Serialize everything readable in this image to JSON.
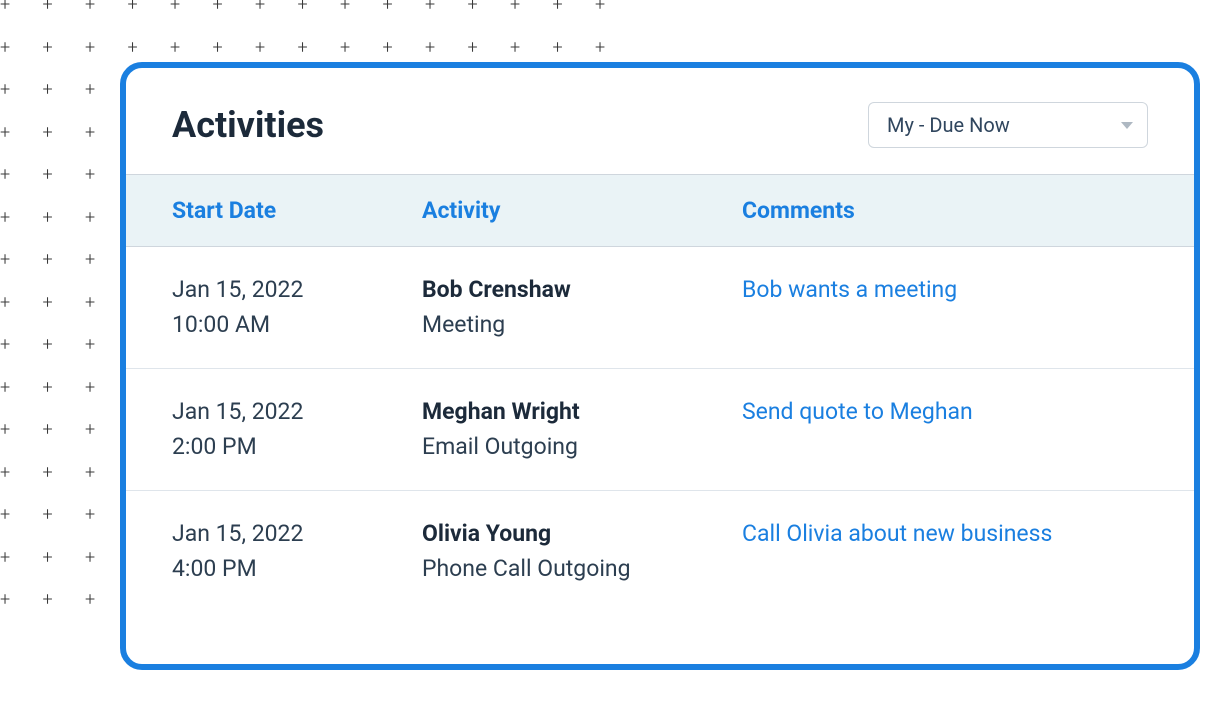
{
  "header": {
    "title": "Activities"
  },
  "filter": {
    "selected": "My - Due Now"
  },
  "columns": {
    "start_date": "Start Date",
    "activity": "Activity",
    "comments": "Comments"
  },
  "rows": [
    {
      "date": "Jan 15, 2022",
      "time": "10:00 AM",
      "contact": "Bob Crenshaw",
      "type": "Meeting",
      "comment": "Bob wants a meeting"
    },
    {
      "date": "Jan 15, 2022",
      "time": "2:00 PM",
      "contact": "Meghan Wright",
      "type": "Email Outgoing",
      "comment": "Send quote to Meghan"
    },
    {
      "date": "Jan 15, 2022",
      "time": "4:00 PM",
      "contact": "Olivia Young",
      "type": "Phone Call Outgoing",
      "comment": "Call Olivia about new business"
    }
  ]
}
